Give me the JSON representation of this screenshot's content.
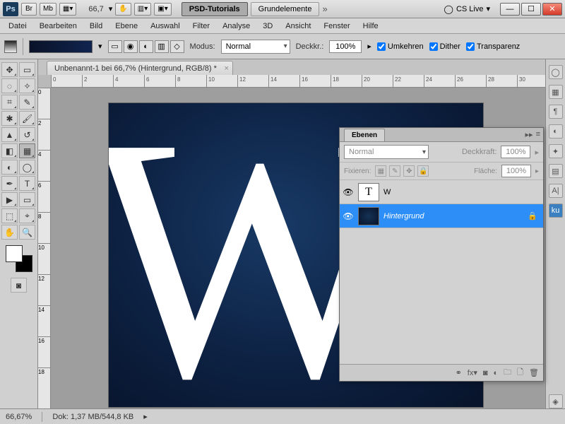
{
  "titlebar": {
    "zoom_dropdown": "66,7",
    "workspace_tabs": [
      "PSD-Tutorials",
      "Grundelemente"
    ],
    "cslive": "CS Live"
  },
  "menu": [
    "Datei",
    "Bearbeiten",
    "Bild",
    "Ebene",
    "Auswahl",
    "Filter",
    "Analyse",
    "3D",
    "Ansicht",
    "Fenster",
    "Hilfe"
  ],
  "optbar": {
    "mode_label": "Modus:",
    "mode_value": "Normal",
    "opacity_label": "Deckkr.:",
    "opacity_value": "100%",
    "chk_reverse": "Umkehren",
    "chk_dither": "Dither",
    "chk_transparency": "Transparenz"
  },
  "document": {
    "tab_title": "Unbenannt-1 bei 66,7% (Hintergrund, RGB/8) *",
    "ruler_ticks_top": [
      "0",
      "2",
      "4",
      "6",
      "8",
      "10",
      "12",
      "14",
      "16",
      "18",
      "20",
      "22",
      "24",
      "26",
      "28",
      "30"
    ],
    "ruler_ticks_left": [
      "0",
      "2",
      "4",
      "6",
      "8",
      "10",
      "12",
      "14",
      "16",
      "18"
    ],
    "letter": "W"
  },
  "layers_panel": {
    "title": "Ebenen",
    "blend_mode": "Normal",
    "opacity_label": "Deckkraft:",
    "opacity_value": "100%",
    "lock_label": "Fixieren:",
    "fill_label": "Fläche:",
    "fill_value": "100%",
    "layers": [
      {
        "name": "W",
        "type": "text",
        "selected": false,
        "locked": false
      },
      {
        "name": "Hintergrund",
        "type": "bg",
        "selected": true,
        "locked": true
      }
    ]
  },
  "statusbar": {
    "zoom": "66,67%",
    "doc_info": "Dok: 1,37 MB/544,8 KB"
  }
}
